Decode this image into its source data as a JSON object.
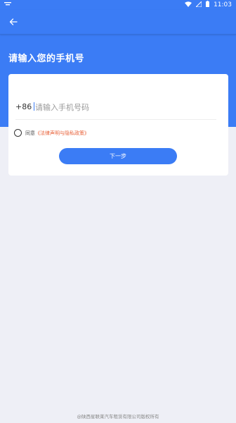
{
  "status_bar": {
    "time": "11:03",
    "icons": [
      "notification-icon",
      "wifi-icon",
      "signal-icon",
      "battery-icon"
    ]
  },
  "app_bar": {
    "back_icon": "arrow-left-icon"
  },
  "page": {
    "title": "请输入您的手机号"
  },
  "form": {
    "country_code": "+86",
    "phone_placeholder": "请输入手机号码",
    "phone_value": "",
    "agree_prefix": "同意",
    "agree_link": "《法律声明与隐私政策》",
    "agree_checked": false,
    "next_label": "下一步"
  },
  "footer": {
    "copyright": "@陕西星联莱汽车租赁有限公司版权所有"
  },
  "colors": {
    "primary": "#3b7cf5",
    "background": "#eeeff6",
    "link": "#e8623a"
  }
}
